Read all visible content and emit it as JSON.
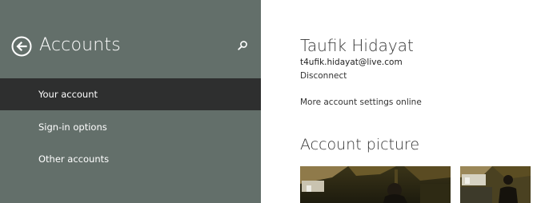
{
  "left_pane": {
    "title": "Accounts",
    "back_icon": "back-arrow-circle-icon",
    "search_icon": "search-icon",
    "background_color": "#636f6a",
    "selected_color": "#2e2f2f",
    "nav_items": [
      {
        "label": "Your account",
        "selected": true
      },
      {
        "label": "Sign-in options",
        "selected": false
      },
      {
        "label": "Other accounts",
        "selected": false
      }
    ]
  },
  "account": {
    "name": "Taufik Hidayat",
    "email": "t4ufik.hidayat@live.com",
    "disconnect_label": "Disconnect",
    "more_settings_label": "More account settings online"
  },
  "account_picture": {
    "heading": "Account picture"
  }
}
